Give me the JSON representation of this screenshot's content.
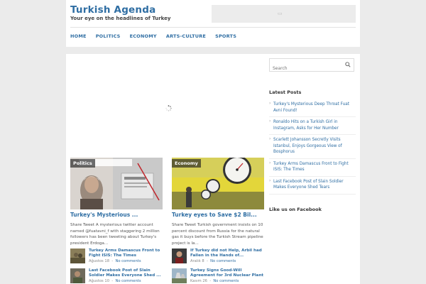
{
  "site": {
    "title": "Turkish Agenda",
    "tagline": "Your eye on the headlines of Turkey"
  },
  "nav": {
    "items": [
      "HOME",
      "POLITICS",
      "ECONOMY",
      "ARTS-CULTURE",
      "SPORTS"
    ]
  },
  "slider": {
    "loading_icon": "spinner-icon"
  },
  "featured": [
    {
      "category": "Politics",
      "title": "Turkey's Mysterious ...",
      "excerpt": "Share Tweet A mysterious twitter account named @fuatavni_f with staggering 2 million followers has been tweeting about Turkey's president Erdoga..."
    },
    {
      "category": "Economy",
      "title": "Turkey eyes to Save $2 Bil...",
      "excerpt": "Share Tweet Turkish government insists on 10 percent discount from Russia for the natural gas it buys before the Turkish Stream pipeline project is la..."
    }
  ],
  "mini_posts": [
    {
      "title": "Turkey Arms Damascus Front to Fight ISIS: The Times",
      "date": "Ağustos 18",
      "comments": "No comments"
    },
    {
      "title": "If Turkey did not Help, Arbil had Fallen in the Hands of...",
      "date": "Aralık 8",
      "comments": "No comments"
    },
    {
      "title": "Last Facebook Post of Slain Soldier Makes Everyone Shed ...",
      "date": "Ağustos 10",
      "comments": "No comments"
    },
    {
      "title": "Turkey Signs Good-Will Agreement for 3rd Nuclear Plant",
      "date": "Kasım 26",
      "comments": "No comments"
    }
  ],
  "sidebar": {
    "search_placeholder": "Search",
    "recent_title": "Latest Posts",
    "recent_posts": [
      "Turkey's Mysterious Deep Throat Fuat Avni Found!",
      "Ronaldo Hits on a Turkish Girl in Instagram, Asks for Her Number",
      "Scarlett Johansson Secretly Visits Istanbul, Enjoys Gorgeous View of Bosphorus",
      "Turkey Arms Damascus Front to Fight ISIS: The Times",
      "Last Facebook Post of Slain Soldier Makes Everyone Shed Tears"
    ],
    "facebook_title": "Like us on Facebook"
  },
  "colors": {
    "link": "#2f6ea3",
    "background": "#ebebeb"
  }
}
